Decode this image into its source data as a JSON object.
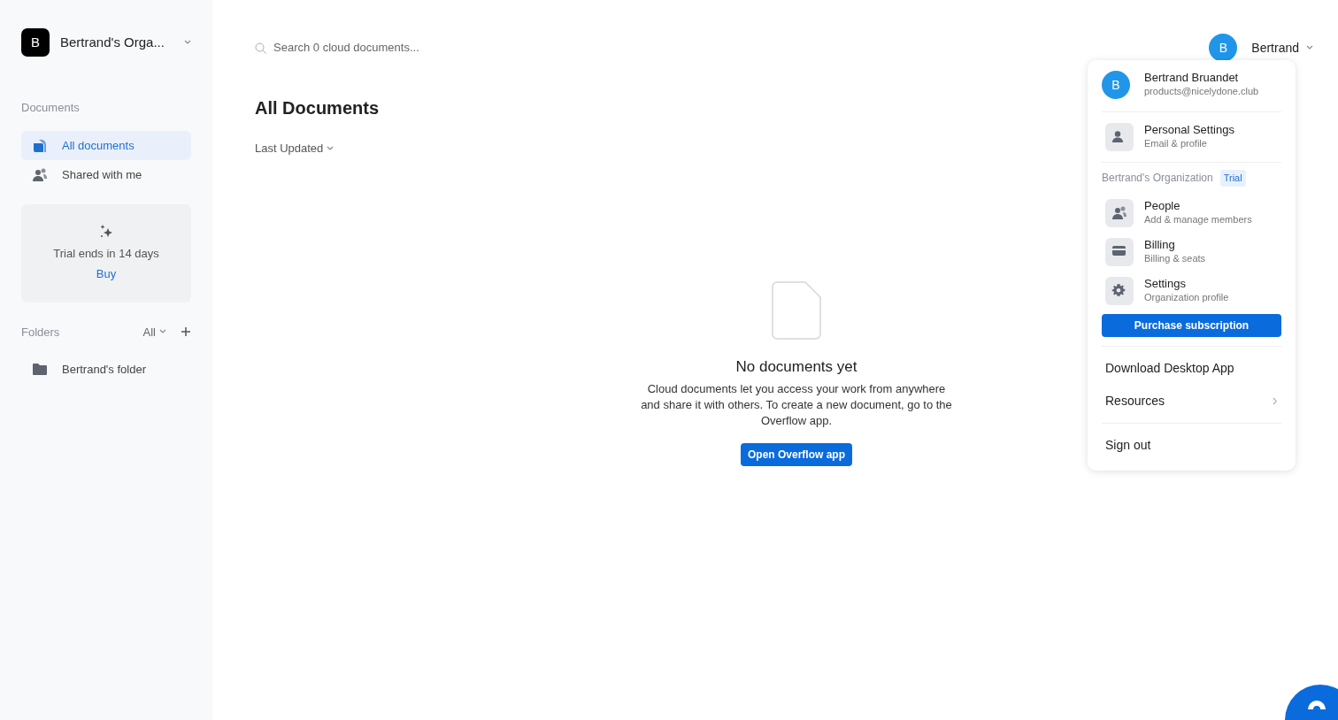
{
  "sidebar": {
    "org": {
      "avatar": "B",
      "name": "Bertrand's Orga..."
    },
    "section_label": "Documents",
    "nav": [
      {
        "label": "All documents",
        "selected": true
      },
      {
        "label": "Shared with me",
        "selected": false
      }
    ],
    "trial": {
      "text": "Trial ends in 14 days",
      "link": "Buy"
    },
    "folders": {
      "label": "Folders",
      "filter": "All",
      "items": [
        {
          "name": "Bertrand's folder"
        }
      ]
    }
  },
  "main": {
    "search": {
      "placeholder": "Search 0 cloud documents..."
    },
    "title": "All Documents",
    "sort": "Last Updated",
    "empty": {
      "title": "No documents yet",
      "description": "Cloud documents let you access your work from anywhere and share it with others. To create a new document, go to the Overflow app.",
      "button": "Open Overflow app"
    }
  },
  "user": {
    "avatar": "B",
    "name": "Bertrand"
  },
  "menu": {
    "profile": {
      "avatar": "B",
      "name": "Bertrand Bruandet",
      "email": "products@nicelydone.club"
    },
    "account_items": [
      {
        "title": "Personal Settings",
        "subtitle": "Email & profile"
      }
    ],
    "org_label": "Bertrand's Organization",
    "org_badge": "Trial",
    "org_items": [
      {
        "title": "People",
        "subtitle": "Add & manage members"
      },
      {
        "title": "Billing",
        "subtitle": "Billing & seats"
      },
      {
        "title": "Settings",
        "subtitle": "Organization profile"
      }
    ],
    "purchase_button": "Purchase subscription",
    "links": [
      {
        "label": "Download Desktop App",
        "submenu": false
      },
      {
        "label": "Resources",
        "submenu": true
      }
    ],
    "sign_out": "Sign out"
  }
}
